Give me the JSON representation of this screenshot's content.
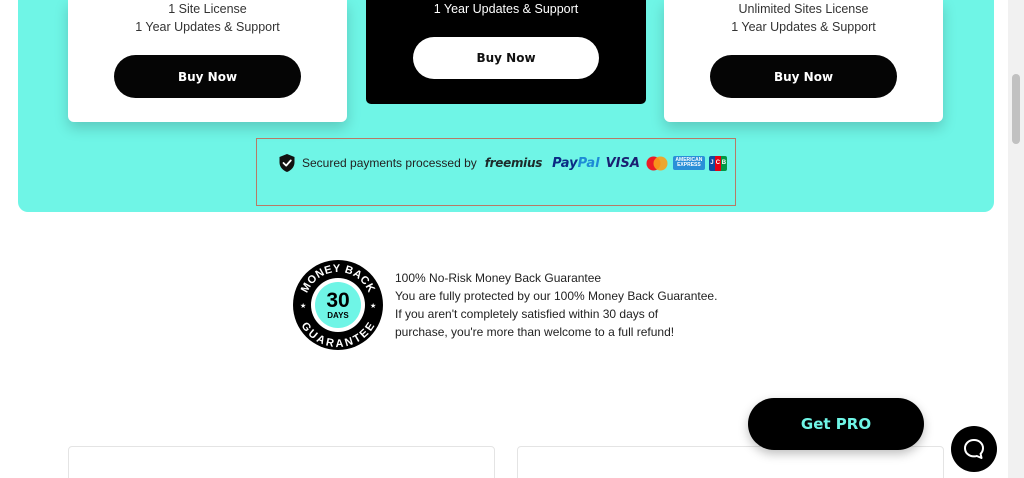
{
  "pricing": {
    "left": {
      "lines": [
        "1 Site License",
        "1 Year Updates & Support"
      ],
      "button": "Buy Now"
    },
    "middle": {
      "lines": [
        "1 Year Updates & Support"
      ],
      "button": "Buy Now"
    },
    "right": {
      "lines": [
        "Unlimited Sites License",
        "1 Year Updates & Support"
      ],
      "button": "Buy Now"
    }
  },
  "payments": {
    "text": "Secured payments processed by",
    "freemius": "freemius",
    "paypal_pay": "Pay",
    "paypal_pal": "Pal",
    "visa": "VISA",
    "icons": [
      "shield-check-icon",
      "mastercard-icon",
      "amex-icon",
      "jcb-icon"
    ]
  },
  "badge": {
    "top_text": "MONEY BACK",
    "number": "30",
    "unit": "DAYS",
    "bottom_text": "GUARANTEE"
  },
  "guarantee": {
    "lines": [
      "100% No-Risk Money Back Guarantee",
      "You are fully protected by our 100% Money Back Guarantee.",
      "If you aren't completely satisfied within 30 days of",
      "purchase, you're more than welcome to a full refund!"
    ]
  },
  "cta": {
    "label": "Get PRO"
  },
  "colors": {
    "accent": "#6ff5e6",
    "dark": "#000000",
    "border": "#b77a66"
  }
}
